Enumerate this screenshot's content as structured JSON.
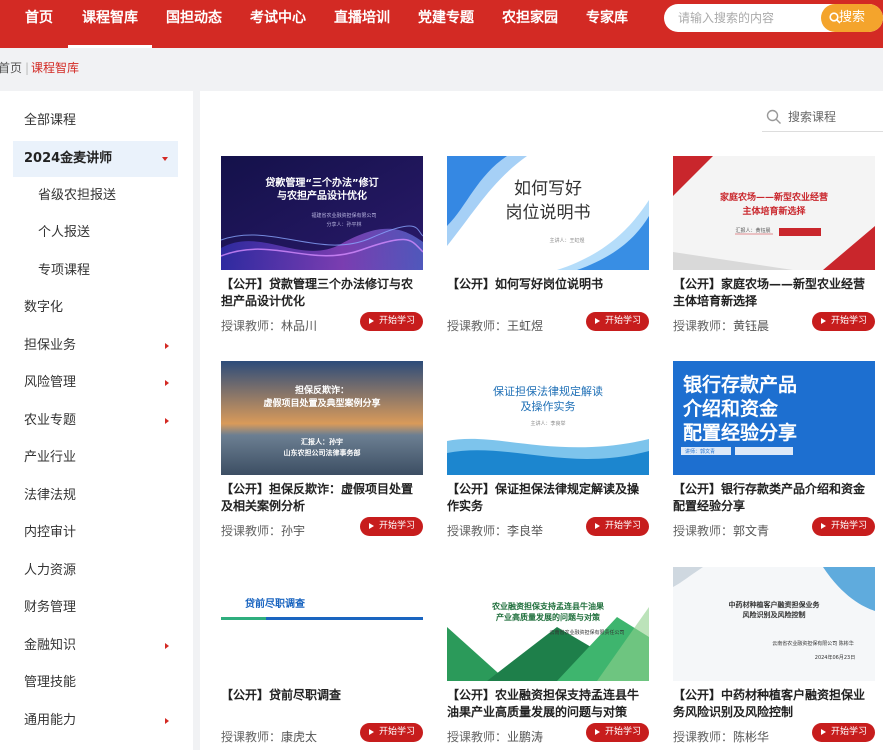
{
  "nav": {
    "items": [
      "首页",
      "课程智库",
      "国担动态",
      "考试中心",
      "直播培训",
      "党建专题",
      "农担家园",
      "专家库"
    ],
    "active_index": 1,
    "search_placeholder": "请输入搜索的内容",
    "search_button": "搜索"
  },
  "breadcrumb": {
    "home": "首页",
    "separator": "|",
    "current": "课程智库"
  },
  "sidebar": {
    "items": [
      {
        "label": "全部课程",
        "arrow": false
      },
      {
        "label": "2024金麦讲师",
        "arrow": true,
        "active": true,
        "expanded": true
      },
      {
        "label": "省级农担报送",
        "sub": true
      },
      {
        "label": "个人报送",
        "sub": true
      },
      {
        "label": "专项课程",
        "sub": true
      },
      {
        "label": "数字化",
        "arrow": false
      },
      {
        "label": "担保业务",
        "arrow": true
      },
      {
        "label": "风险管理",
        "arrow": true
      },
      {
        "label": "农业专题",
        "arrow": true
      },
      {
        "label": "产业行业",
        "arrow": false
      },
      {
        "label": "法律法规",
        "arrow": false
      },
      {
        "label": "内控审计",
        "arrow": false
      },
      {
        "label": "人力资源",
        "arrow": false
      },
      {
        "label": "财务管理",
        "arrow": false
      },
      {
        "label": "金融知识",
        "arrow": true
      },
      {
        "label": "管理技能",
        "arrow": false
      },
      {
        "label": "通用能力",
        "arrow": true
      }
    ]
  },
  "main": {
    "search_placeholder": "搜索课程",
    "teacher_label": "授课教师：",
    "play_label": "开始学习",
    "courses": [
      {
        "title": "【公开】贷款管理三个办法修订与农担产品设计优化",
        "teacher": "林品川",
        "thumb": {
          "lines": [
            "贷款管理“三个办法”修订",
            "与农担产品设计优化"
          ],
          "small": [
            "福建省农业融资担保有限公司",
            "分享人：孙平林"
          ]
        }
      },
      {
        "title": "【公开】如何写好岗位说明书",
        "teacher": "王虹煜",
        "thumb": {
          "lines": [
            "如何写好",
            "岗位说明书"
          ],
          "small": [
            "主讲人：王虹煜"
          ]
        }
      },
      {
        "title": "【公开】家庭农场——新型农业经营主体培育新选择",
        "teacher": "黄钰晨",
        "thumb": {
          "lines": [
            "家庭农场——新型农业经营",
            "主体培育新选择"
          ],
          "small": [
            "汇报人：黄钰晨"
          ]
        }
      },
      {
        "title": "【公开】担保反欺诈：虚假项目处置及相关案例分析",
        "teacher": "孙宇",
        "thumb": {
          "lines": [
            "担保反欺诈：",
            "虚假项目处置及典型案例分享"
          ],
          "small": [
            "汇报人：孙宇",
            "山东农担公司法律事务部"
          ]
        }
      },
      {
        "title": "【公开】保证担保法律规定解读及操作实务",
        "teacher": "李良举",
        "thumb": {
          "lines": [
            "保证担保法律规定解读",
            "及操作实务"
          ],
          "small": [
            "主讲人：李良举"
          ]
        }
      },
      {
        "title": "【公开】银行存款类产品介绍和资金配置经验分享",
        "teacher": "郭文青",
        "thumb": {
          "lines": [
            "银行存款产品",
            "介绍和资金",
            "配置经验分享"
          ],
          "small": [
            "讲师：郭文青"
          ]
        }
      },
      {
        "title": "【公开】贷前尽职调查",
        "teacher": "康虎太",
        "thumb": {
          "lines": [
            "贷前尽职调查"
          ],
          "small": []
        }
      },
      {
        "title": "【公开】农业融资担保支持孟连县牛油果产业高质量发展的问题与对策",
        "teacher": "业鹏涛",
        "thumb": {
          "lines": [
            "农业融资担保支持孟连县牛油果",
            "产业高质量发展的问题与对策"
          ],
          "small": [
            "云南省农业融资担保有限责任公司"
          ]
        }
      },
      {
        "title": "【公开】中药材种植客户融资担保业务风险识别及风险控制",
        "teacher": "陈彬华",
        "thumb": {
          "lines": [
            "中药材种植客户融资担保业务",
            "风险识别及风险控制"
          ],
          "small": [
            "云南省农业融资担保有限公司 陈彬华",
            "2024年06月23日"
          ]
        }
      }
    ]
  },
  "colors": {
    "brand_red": "#d32a24",
    "search_orange": "#f4a42c",
    "active_bg": "#eaf2fb"
  }
}
